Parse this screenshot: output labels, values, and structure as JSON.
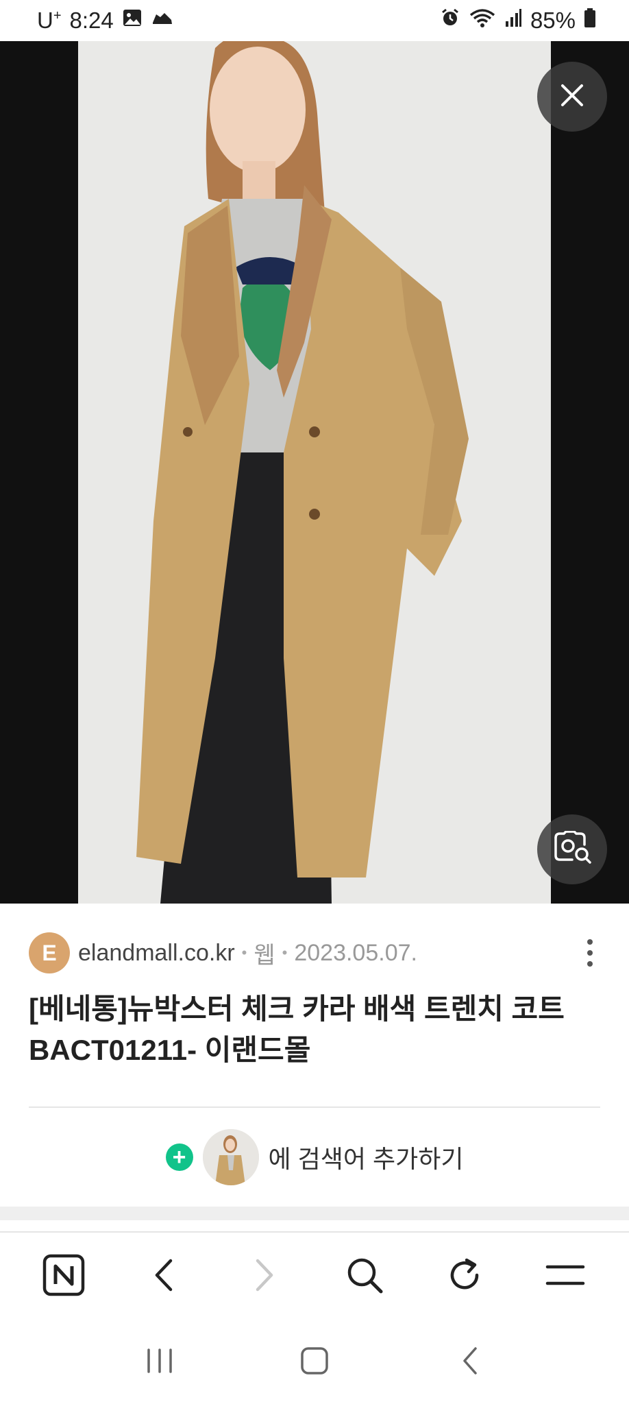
{
  "status_bar": {
    "carrier": "U",
    "carrier_sup": "+",
    "time": "8:24",
    "battery": "85%"
  },
  "viewer": {
    "close_label": "close",
    "lens_label": "image search"
  },
  "result": {
    "source_initial": "E",
    "domain": "elandmall.co.kr",
    "separator": "•",
    "type": "웹",
    "date": "2023.05.07.",
    "title": "[베네통]뉴박스터 체크 카라 배색 트렌치 코트 BACT01211- 이랜드몰",
    "add_label": "에 검색어 추가하기"
  },
  "toolbar": {
    "items": [
      "naver-home",
      "back",
      "forward",
      "search",
      "refresh",
      "menu"
    ]
  },
  "colors": {
    "coat": "#c9a46a",
    "accent_green": "#11c38a",
    "avatar": "#d9a46d"
  }
}
